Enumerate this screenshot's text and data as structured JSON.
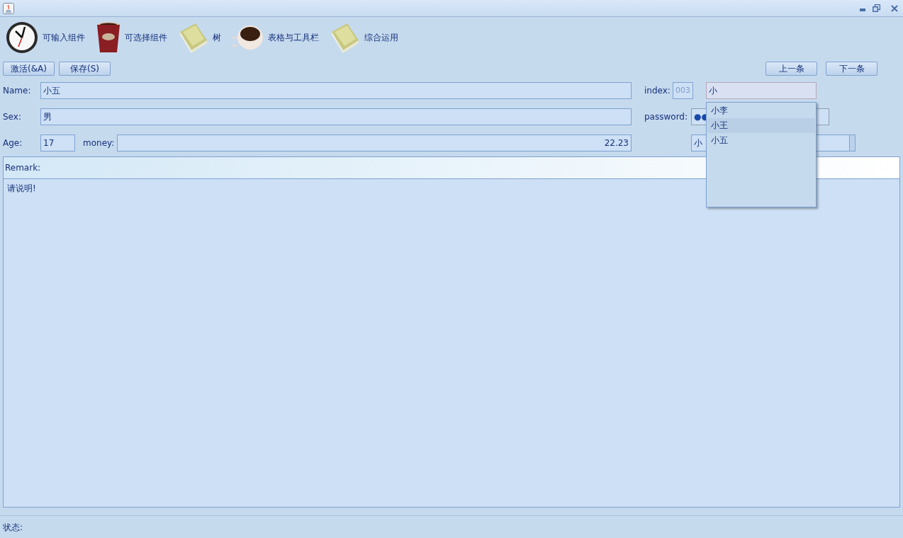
{
  "toolbar": [
    {
      "label": "可输入组件",
      "kind": "clock"
    },
    {
      "label": "可选择组件",
      "kind": "cup"
    },
    {
      "label": "树",
      "kind": "book"
    },
    {
      "label": "表格与工具栏",
      "kind": "coffee"
    },
    {
      "label": "综合运用",
      "kind": "book"
    }
  ],
  "left_buttons": [
    "激活(&A)",
    "保存(S)"
  ],
  "right_buttons": [
    "上一条",
    "下一条"
  ],
  "form": {
    "name_label": "Name:",
    "name_value": "小五",
    "index_label": "index:",
    "index_value": "003",
    "combo_input": "小",
    "sex_label": "Sex:",
    "sex_value": "男",
    "password_label": "password:",
    "password_value": "●●",
    "age_label": "Age:",
    "age_value": "17",
    "money_label": "money:",
    "money_value": "22.23",
    "combo2_value": "小"
  },
  "popup": [
    {
      "label": "小李",
      "selected": false
    },
    {
      "label": "小王",
      "selected": true
    },
    {
      "label": "小五",
      "selected": false
    }
  ],
  "remark": {
    "label": "Remark:",
    "text": "请说明!"
  },
  "status_bar": "状态:"
}
